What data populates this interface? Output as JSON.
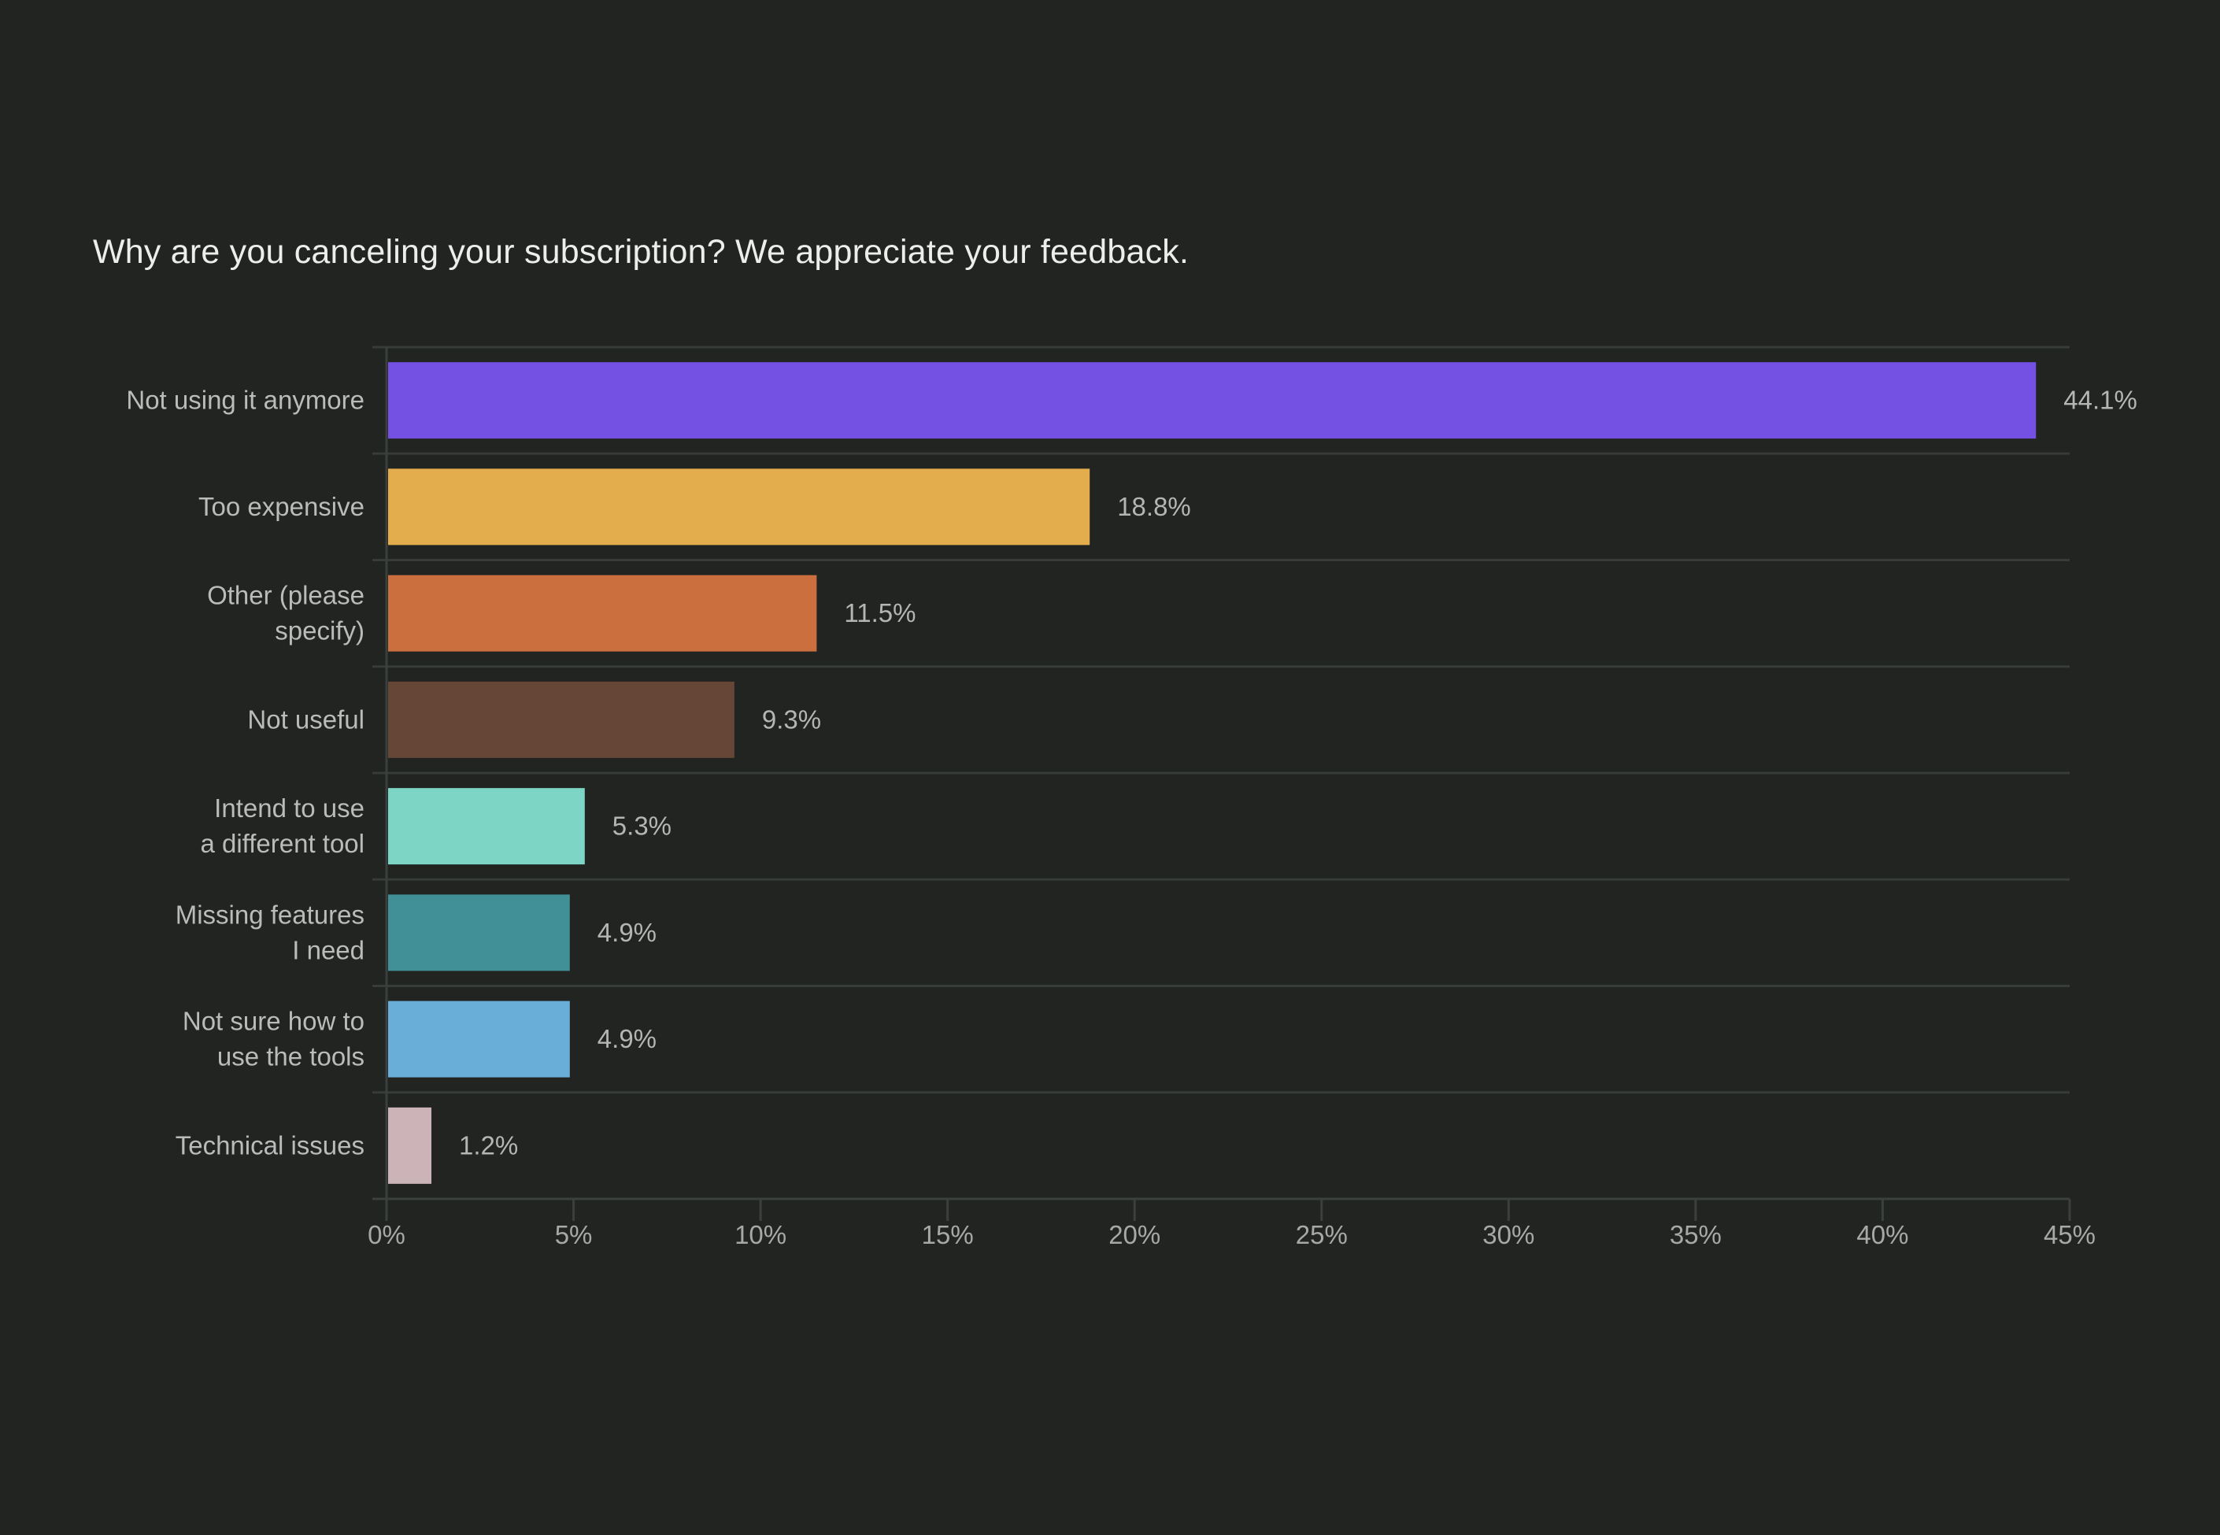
{
  "chart_data": {
    "type": "bar",
    "orientation": "horizontal",
    "title": "Why are you canceling your subscription? We appreciate your feedback.",
    "xlabel": "",
    "ylabel": "",
    "xlim": [
      0,
      45
    ],
    "x_ticks": [
      0,
      5,
      10,
      15,
      20,
      25,
      30,
      35,
      40,
      45
    ],
    "x_tick_labels": [
      "0%",
      "5%",
      "10%",
      "15%",
      "20%",
      "25%",
      "30%",
      "35%",
      "40%",
      "45%"
    ],
    "grid": "horizontal separators between categories",
    "legend": "none",
    "categories": [
      [
        "Not using it anymore"
      ],
      [
        "Too expensive"
      ],
      [
        "Other (please",
        "specify)"
      ],
      [
        "Not useful"
      ],
      [
        "Intend to use",
        "a different tool"
      ],
      [
        "Missing features",
        "I need"
      ],
      [
        "Not sure how to",
        "use the tools"
      ],
      [
        "Technical issues"
      ]
    ],
    "values": [
      44.1,
      18.8,
      11.5,
      9.3,
      5.3,
      4.9,
      4.9,
      1.2
    ],
    "value_labels": [
      "44.1%",
      "18.8%",
      "11.5%",
      "9.3%",
      "5.3%",
      "4.9%",
      "4.9%",
      "1.2%"
    ],
    "colors": [
      "#7450e3",
      "#e3ac4d",
      "#cc6f3f",
      "#664637",
      "#7dd5c5",
      "#429097",
      "#69aed9",
      "#cbb3b8"
    ]
  }
}
